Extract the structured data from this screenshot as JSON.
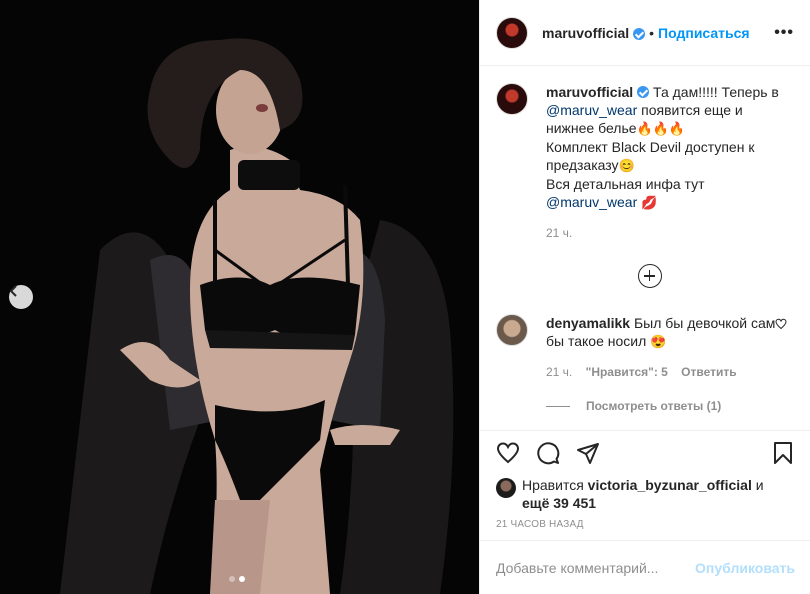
{
  "post": {
    "username": "maruvofficial",
    "bullet": "•",
    "follow_label": "Подписаться",
    "more_label": "•••"
  },
  "caption": {
    "username": "maruvofficial",
    "text_1": " Та дам!!!!! Теперь в ",
    "mention_1": "@maruv_wear",
    "text_2": " появится еще и нижнее белье",
    "emoji_fire": "🔥🔥🔥",
    "text_3": "Комплект Black Devil доступен к предзаказу",
    "emoji_smile": "😊",
    "text_4": "Вся детальная инфа тут",
    "mention_2": "@maruv_wear",
    "emoji_kiss": "💋",
    "time": "21 ч."
  },
  "comment": {
    "username": "denyamalikk",
    "text": " Был бы девочкой сам бы такое носил ",
    "emoji": "😍",
    "time": "21 ч.",
    "likes_label": "\"Нравится\": 5",
    "reply_label": "Ответить",
    "view_replies": "Посмотреть ответы (1)"
  },
  "likes": {
    "prefix": "Нравится ",
    "user": "victoria_byzunar_official",
    "middle": " и ",
    "count": "ещё 39 451"
  },
  "timestamp": "21 ЧАСОВ НАЗАД",
  "add_comment": {
    "placeholder": "Добавьте комментарий...",
    "post_label": "Опубликовать"
  },
  "carousel": {
    "total": 2,
    "active": 2
  },
  "colors": {
    "accent": "#0095f6",
    "verified": "#3897f0",
    "muted": "#8e8e8e",
    "media_bg": "#050505"
  },
  "icons": [
    "chevron-left-icon",
    "more-icon",
    "verified-icon",
    "plus-circle-icon",
    "heart-icon",
    "comment-icon",
    "share-icon",
    "bookmark-icon"
  ]
}
